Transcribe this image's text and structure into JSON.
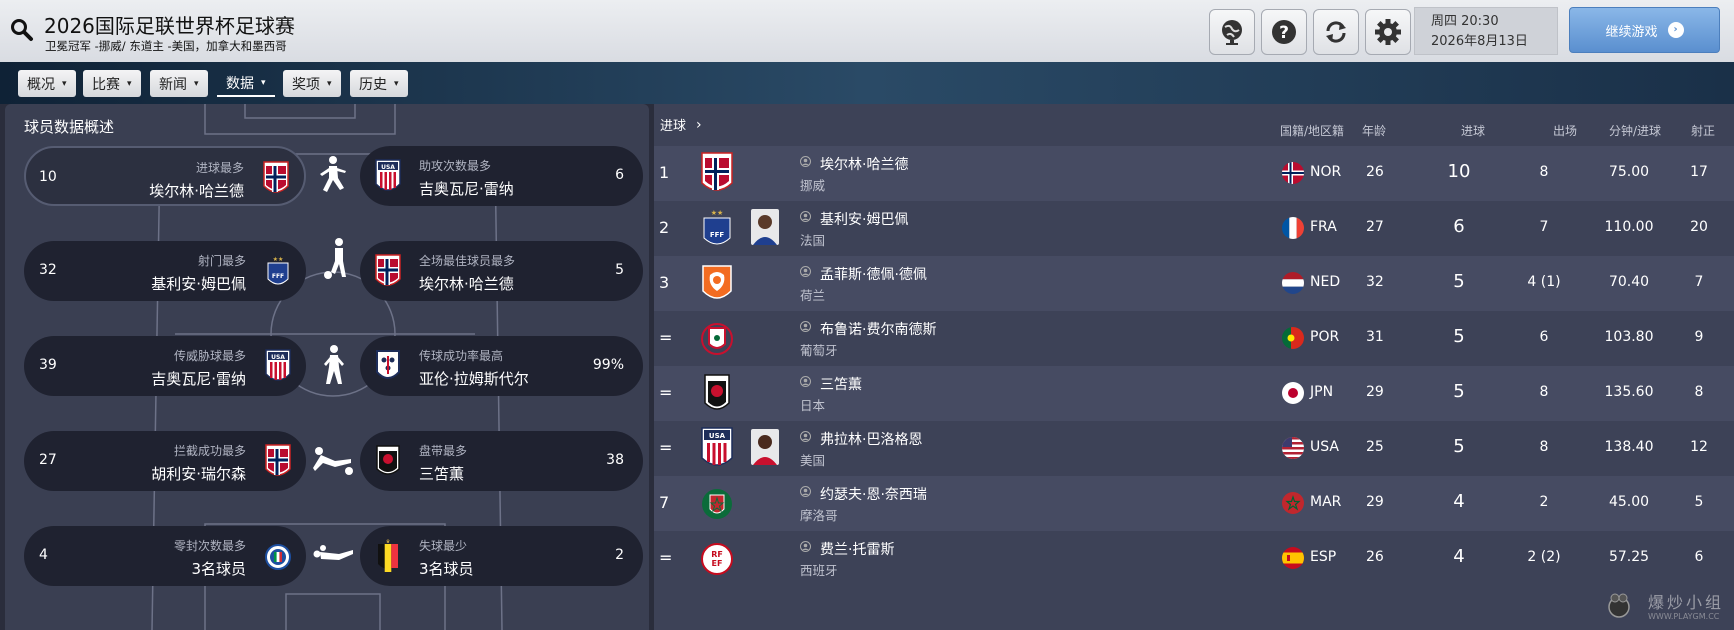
{
  "header": {
    "title": "2026国际足联世界杯足球赛",
    "subtitle": "卫冕冠军 -挪威/ 东道主 -美国，加拿大和墨西哥",
    "icons": [
      "globe-icon",
      "help-icon",
      "refresh-icon",
      "settings-icon"
    ],
    "date_line1": "周四 20:30",
    "date_line2": "2026年8月13日",
    "continue_label": "继续游戏"
  },
  "tabs": [
    {
      "label": "概况"
    },
    {
      "label": "比赛"
    },
    {
      "label": "新闻"
    },
    {
      "label": "数据",
      "active": true
    },
    {
      "label": "奖项"
    },
    {
      "label": "历史"
    }
  ],
  "overview": {
    "title": "球员数据概述",
    "cards": [
      {
        "label": "进球最多",
        "name": "埃尔林·哈兰德",
        "value": "10",
        "team": "NOR"
      },
      {
        "label": "助攻次数最多",
        "name": "吉奥瓦尼·雷纳",
        "value": "6",
        "team": "USA"
      },
      {
        "label": "射门最多",
        "name": "基利安·姆巴佩",
        "value": "32",
        "team": "FRA"
      },
      {
        "label": "全场最佳球员最多",
        "name": "埃尔林·哈兰德",
        "value": "5",
        "team": "NOR"
      },
      {
        "label": "传威胁球最多",
        "name": "吉奥瓦尼·雷纳",
        "value": "39",
        "team": "USA"
      },
      {
        "label": "传球成功率最高",
        "name": "亚伦·拉姆斯代尔",
        "value": "99%",
        "team": "ENG"
      },
      {
        "label": "拦截成功最多",
        "name": "胡利安·瑞尔森",
        "value": "27",
        "team": "NOR"
      },
      {
        "label": "盘带最多",
        "name": "三笘薫",
        "value": "38",
        "team": "JPN"
      },
      {
        "label": "零封次数最多",
        "name": "3名球员",
        "value": "4",
        "team": "FIGC"
      },
      {
        "label": "失球最少",
        "name": "3名球员",
        "value": "2",
        "team": "BEL"
      }
    ]
  },
  "goals_table": {
    "title": "进球",
    "columns": {
      "nation": "国籍/地区籍",
      "age": "年龄",
      "goals": "进球",
      "apps": "出场",
      "mpg": "分钟/进球",
      "sot": "射正"
    },
    "rows": [
      {
        "pos": "1",
        "name": "埃尔林·哈兰德",
        "team": "挪威",
        "nat": "NOR",
        "age": "26",
        "goals": "10",
        "apps": "8",
        "mpg": "75.00",
        "sot": "17"
      },
      {
        "pos": "2",
        "name": "基利安·姆巴佩",
        "team": "法国",
        "nat": "FRA",
        "age": "27",
        "goals": "6",
        "apps": "7",
        "mpg": "110.00",
        "sot": "20"
      },
      {
        "pos": "3",
        "name": "孟菲斯·德佩·德佩",
        "team": "荷兰",
        "nat": "NED",
        "age": "32",
        "goals": "5",
        "apps": "4 (1)",
        "mpg": "70.40",
        "sot": "7"
      },
      {
        "pos": "=",
        "name": "布鲁诺·费尔南德斯",
        "team": "葡萄牙",
        "nat": "POR",
        "age": "31",
        "goals": "5",
        "apps": "6",
        "mpg": "103.80",
        "sot": "9"
      },
      {
        "pos": "=",
        "name": "三笘薫",
        "team": "日本",
        "nat": "JPN",
        "age": "29",
        "goals": "5",
        "apps": "8",
        "mpg": "135.60",
        "sot": "8"
      },
      {
        "pos": "=",
        "name": "弗拉林·巴洛格恩",
        "team": "美国",
        "nat": "USA",
        "age": "25",
        "goals": "5",
        "apps": "8",
        "mpg": "138.40",
        "sot": "12"
      },
      {
        "pos": "7",
        "name": "约瑟夫·恩·奈西瑞",
        "team": "摩洛哥",
        "nat": "MAR",
        "age": "29",
        "goals": "4",
        "apps": "2",
        "mpg": "45.00",
        "sot": "5"
      },
      {
        "pos": "=",
        "name": "费兰·托雷斯",
        "team": "西班牙",
        "nat": "ESP",
        "age": "26",
        "goals": "4",
        "apps": "2 (2)",
        "mpg": "57.25",
        "sot": "6"
      }
    ]
  },
  "watermark": {
    "main": "爆炒小组",
    "sub": "WWW.PLAYGM.CC"
  }
}
